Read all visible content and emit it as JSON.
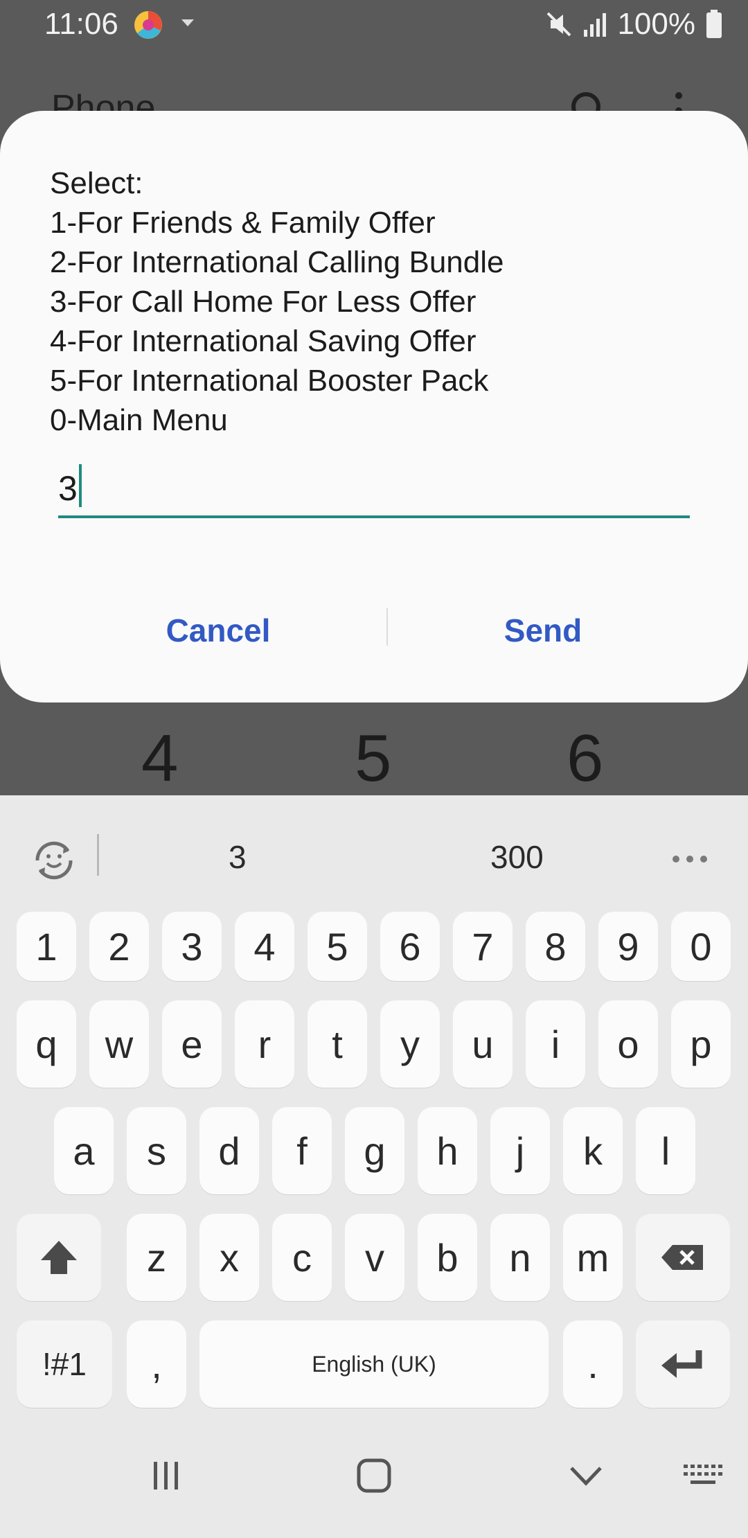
{
  "status_bar": {
    "time": "11:06",
    "battery": "100%",
    "icons": [
      "chrome-canary-icon",
      "dropdown-icon",
      "mute-icon",
      "signal-icon",
      "battery-icon"
    ]
  },
  "background_app": {
    "title": "Phone",
    "dial_digits": [
      "4",
      "5",
      "6"
    ]
  },
  "dialog": {
    "message": "Select:\n1-For Friends & Family Offer\n2-For International Calling Bundle\n3-For Call Home For Less Offer\n4-For International Saving Offer\n5-For International Booster Pack\n0-Main Menu",
    "input_value": "3",
    "cancel_label": "Cancel",
    "send_label": "Send",
    "accent_color": "#1f8a80",
    "button_color": "#3259c4"
  },
  "keyboard": {
    "suggestions": [
      "3",
      "300"
    ],
    "row_numbers": [
      "1",
      "2",
      "3",
      "4",
      "5",
      "6",
      "7",
      "8",
      "9",
      "0"
    ],
    "row_1": [
      "q",
      "w",
      "e",
      "r",
      "t",
      "y",
      "u",
      "i",
      "o",
      "p"
    ],
    "row_2": [
      "a",
      "s",
      "d",
      "f",
      "g",
      "h",
      "j",
      "k",
      "l"
    ],
    "row_3": [
      "z",
      "x",
      "c",
      "v",
      "b",
      "n",
      "m"
    ],
    "symbols_label": "!#1",
    "comma_label": ",",
    "space_label": "English (UK)",
    "period_label": "."
  }
}
